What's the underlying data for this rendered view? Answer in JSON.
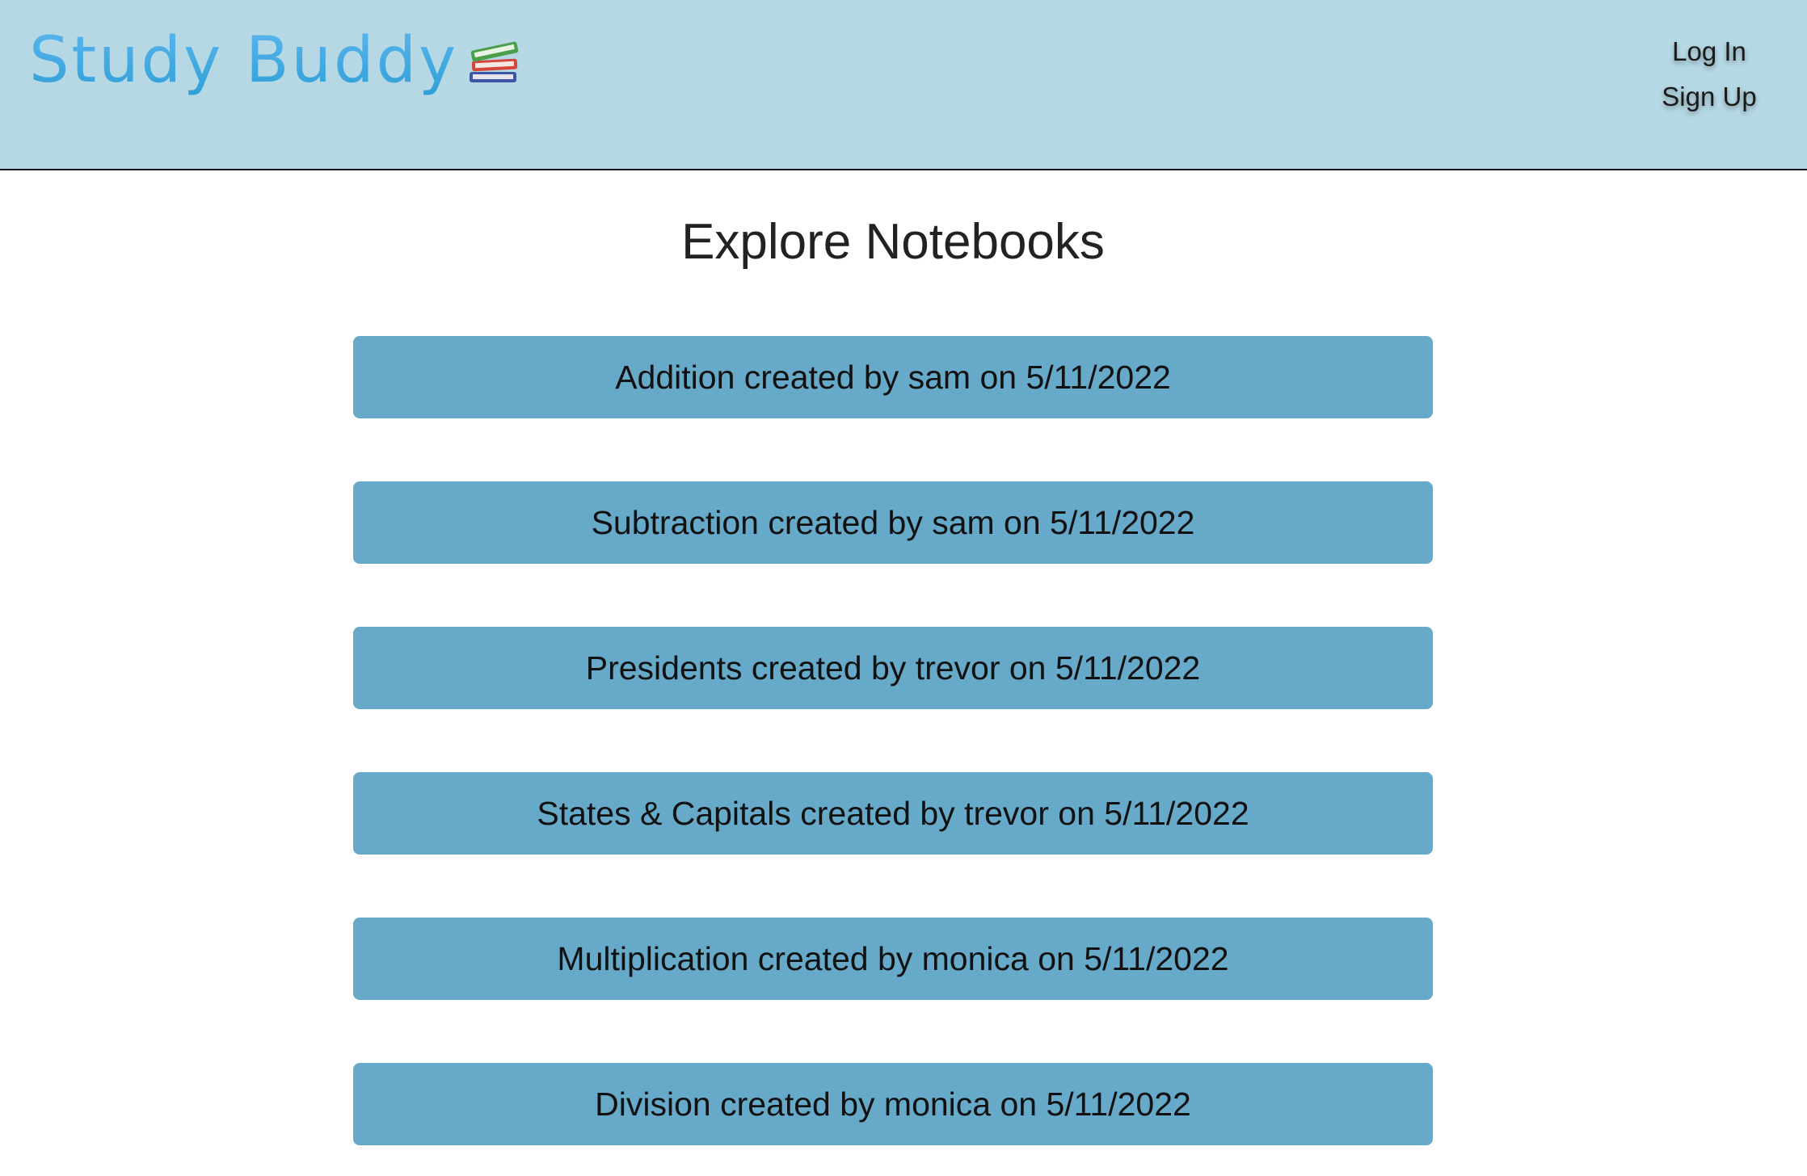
{
  "header": {
    "brand": "Study Buddy",
    "brand_icon": "books-icon",
    "login_label": "Log In",
    "signup_label": "Sign Up",
    "background_color": "#b5d8e4",
    "brand_color": "#3fa9e3"
  },
  "main": {
    "title": "Explore Notebooks",
    "item_color": "#66a9c8",
    "notebooks": [
      {
        "label": "Addition created by sam on 5/11/2022"
      },
      {
        "label": "Subtraction created by sam on 5/11/2022"
      },
      {
        "label": "Presidents created by trevor on 5/11/2022"
      },
      {
        "label": "States & Capitals created by trevor on 5/11/2022"
      },
      {
        "label": "Multiplication created by monica on 5/11/2022"
      },
      {
        "label": "Division created by monica on 5/11/2022"
      }
    ]
  }
}
